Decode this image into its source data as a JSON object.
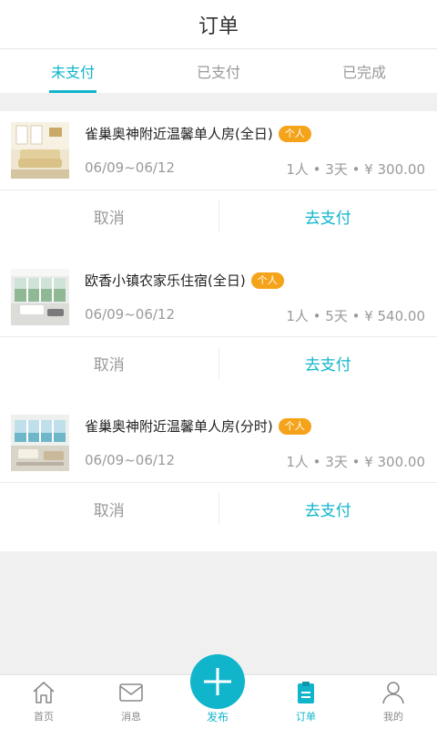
{
  "header": {
    "title": "订单"
  },
  "tabs": [
    {
      "label": "未支付",
      "active": true
    },
    {
      "label": "已支付",
      "active": false
    },
    {
      "label": "已完成",
      "active": false
    }
  ],
  "orders": [
    {
      "name": "雀巢奥神附近温馨单人房(全日)",
      "badge": "个人",
      "dates": "06/09~06/12",
      "meta": "1人 • 3天 • ¥ 300.00",
      "cancel": "取消",
      "pay": "去支付",
      "thumb": "living-room-sofa"
    },
    {
      "name": "欧香小镇农家乐住宿(全日)",
      "badge": "个人",
      "dates": "06/09~06/12",
      "meta": "1人 • 5天 • ¥ 540.00",
      "cancel": "取消",
      "pay": "去支付",
      "thumb": "living-room-window"
    },
    {
      "name": "雀巢奥神附近温馨单人房(分时)",
      "badge": "个人",
      "dates": "06/09~06/12",
      "meta": "1人 • 3天 • ¥ 300.00",
      "cancel": "取消",
      "pay": "去支付",
      "thumb": "living-room-seaview"
    }
  ],
  "tabbar": {
    "items": [
      {
        "label": "首页",
        "icon": "home-icon"
      },
      {
        "label": "消息",
        "icon": "message-icon"
      },
      {
        "label": "发布",
        "icon": "plus-icon"
      },
      {
        "label": "订单",
        "icon": "order-icon",
        "active": true
      },
      {
        "label": "我的",
        "icon": "profile-icon"
      }
    ]
  },
  "colors": {
    "accent": "#10b5cc",
    "badge": "#f5a31a",
    "background": "#f1f0f0"
  }
}
